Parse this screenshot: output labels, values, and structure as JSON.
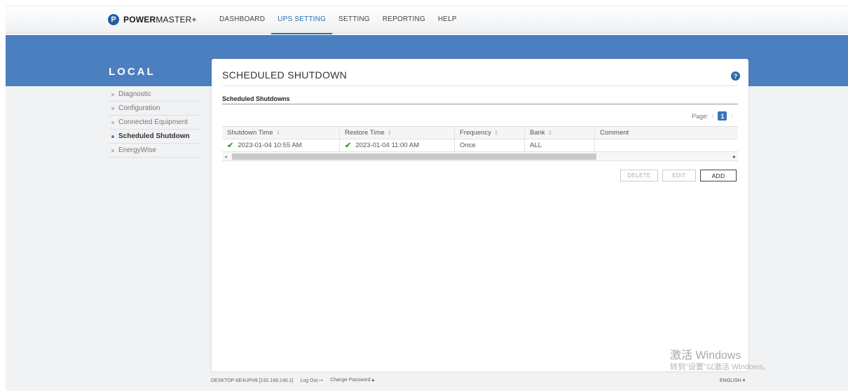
{
  "brand": {
    "logo_letter": "P",
    "name_bold": "POWER",
    "name_rest": "MASTER+"
  },
  "nav": [
    {
      "label": "DASHBOARD",
      "active": false
    },
    {
      "label": "UPS SETTING",
      "active": true
    },
    {
      "label": "SETTING",
      "active": false
    },
    {
      "label": "REPORTING",
      "active": false
    },
    {
      "label": "HELP",
      "active": false
    }
  ],
  "colors": {
    "band": "#4c7fbf",
    "accent": "#2c6cb0",
    "check": "#3a9a3a"
  },
  "sidebar": {
    "heading": "LOCAL",
    "items": [
      {
        "label": "Diagnostic",
        "active": false
      },
      {
        "label": "Configuration",
        "active": false
      },
      {
        "label": "Connected Equipment",
        "active": false
      },
      {
        "label": "Scheduled Shutdown",
        "active": true
      },
      {
        "label": "EnergyWise",
        "active": false
      }
    ]
  },
  "panel": {
    "title": "SCHEDULED SHUTDOWN",
    "help_icon": "?",
    "section_title": "Scheduled Shutdowns",
    "pager": {
      "label": "Page:",
      "current": "1",
      "prev": "‹",
      "next": "›"
    },
    "table": {
      "headers": [
        "Shutdown Time",
        "Restore Time",
        "Frequency",
        "Bank",
        "Comment"
      ],
      "rows": [
        {
          "shutdown": "2023-01-04 10:55 AM",
          "restore": "2023-01-04 11:00 AM",
          "frequency": "Once",
          "bank": "ALL",
          "comment": ""
        }
      ]
    },
    "buttons": {
      "delete": "DELETE",
      "edit": "EDIT",
      "add": "ADD"
    }
  },
  "footer": {
    "host": "DESKTOP-6E4UPH9 [192.168.146.1]",
    "logout": "Log Out",
    "change_password": "Change Password",
    "language": "ENGLISH"
  },
  "watermark": {
    "line1": "激活 Windows",
    "line2": "转到\"设置\"以激活 Windows。"
  }
}
